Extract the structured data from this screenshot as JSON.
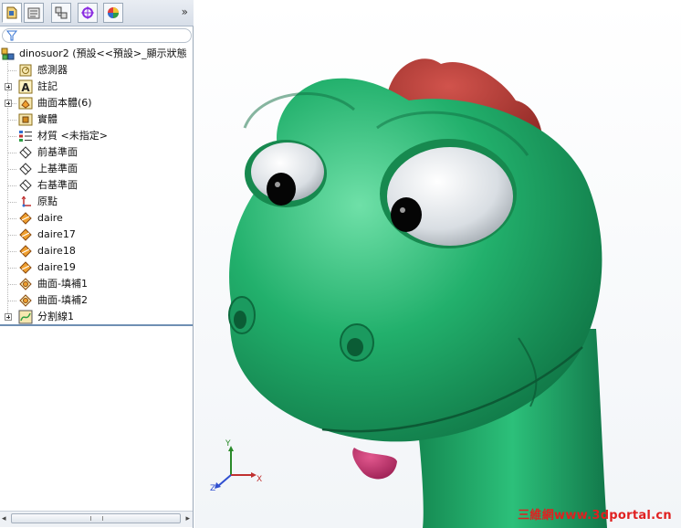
{
  "panel": {
    "tabs": [
      {
        "name": "featuremanager",
        "icon": "featuremanager-tab-icon"
      },
      {
        "name": "propertymanager",
        "icon": "propertymanager-tab-icon"
      },
      {
        "name": "configurationmanager",
        "icon": "configurationmanager-tab-icon"
      },
      {
        "name": "dimxpert",
        "icon": "dimxpert-tab-icon"
      },
      {
        "name": "display-manager",
        "icon": "display-manager-tab-icon"
      }
    ],
    "more": "»",
    "tree": {
      "root_label": "dinosuor2  (預設<<預設>_顯示狀態",
      "items": [
        {
          "label": "感測器",
          "icon": "sensor-icon"
        },
        {
          "label": "註記",
          "icon": "annotation-icon"
        },
        {
          "label": "曲面本體(6)",
          "icon": "surface-bodies-icon"
        },
        {
          "label": "實體",
          "icon": "solid-bodies-icon"
        },
        {
          "label": "材質 <未指定>",
          "icon": "material-icon"
        },
        {
          "label": "前基準面",
          "icon": "plane-icon"
        },
        {
          "label": "上基準面",
          "icon": "plane-icon"
        },
        {
          "label": "右基準面",
          "icon": "plane-icon"
        },
        {
          "label": "原點",
          "icon": "origin-icon"
        },
        {
          "label": "daire",
          "icon": "sketch-icon"
        },
        {
          "label": "daire17",
          "icon": "sketch-icon"
        },
        {
          "label": "daire18",
          "icon": "sketch-icon"
        },
        {
          "label": "daire19",
          "icon": "sketch-icon"
        },
        {
          "label": "曲面-填補1",
          "icon": "fill-surface-icon"
        },
        {
          "label": "曲面-填補2",
          "icon": "fill-surface-icon"
        },
        {
          "label": "分割線1",
          "icon": "split-line-icon"
        }
      ]
    },
    "scrollbar": {
      "left": "◂",
      "right": "▸"
    }
  },
  "viewport": {
    "triad": {
      "x": "X",
      "y": "Y",
      "z": "Z"
    },
    "watermark": "三維網www.3dportal.cn"
  },
  "colors": {
    "body_green": "#22a86a",
    "crest_red": "#b53a35",
    "tongue": "#c0306a",
    "tree_line": "#6f8fb3"
  }
}
